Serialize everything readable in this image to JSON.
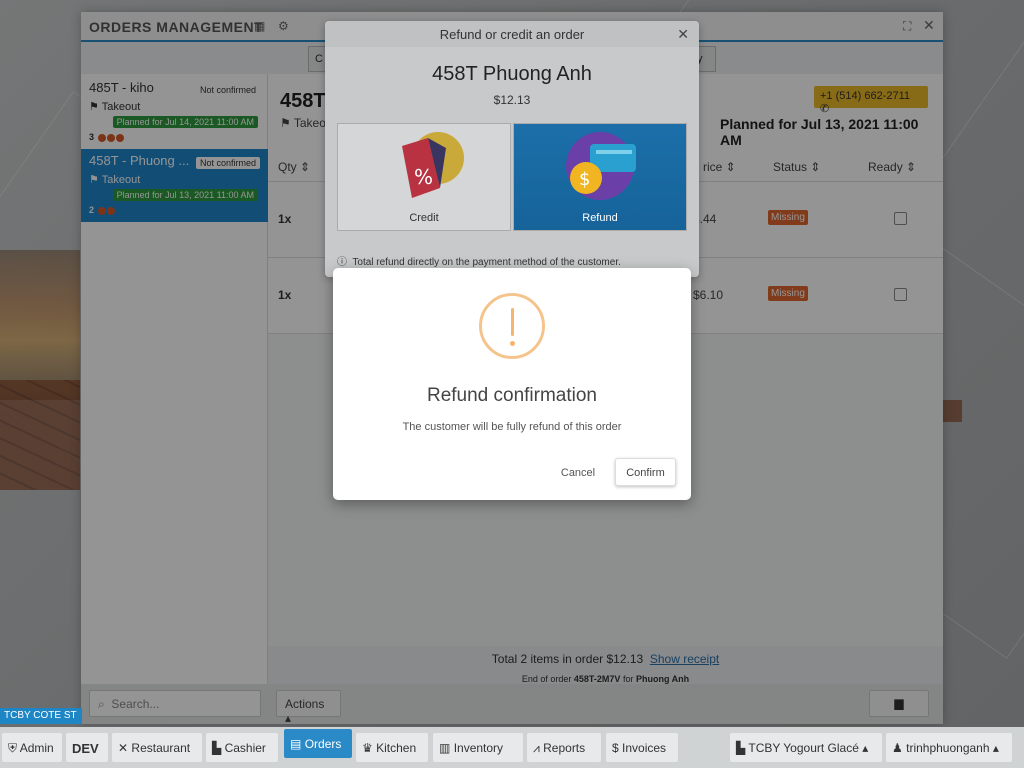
{
  "window": {
    "title": "ORDERS MANAGEMENT"
  },
  "tabs": [
    {
      "label": "C"
    },
    {
      "label": "y"
    }
  ],
  "orders": [
    {
      "name": "485T - kiho",
      "status": "Not confirmed",
      "type": "Takeout",
      "planned": "Planned for Jul 14, 2021 11:00 AM",
      "count": "3"
    },
    {
      "name": "458T - Phuong ...",
      "status": "Not confirmed",
      "type": "Takeout",
      "planned": "Planned for Jul 13, 2021 11:00 AM",
      "count": "2"
    }
  ],
  "detail": {
    "title": "458T",
    "type": "Takeout",
    "phone": "+1 (514) 662-2711",
    "planned": "Planned for Jul 13, 2021 11:00 AM",
    "columns": {
      "qty": "Qty",
      "price": "rice",
      "status": "Status",
      "ready": "Ready"
    },
    "items": [
      {
        "qty": "1x",
        "price": "4.44",
        "status": "Missing"
      },
      {
        "qty": "1x",
        "price": "$6.10",
        "status": "Missing"
      }
    ],
    "total_text": "Total 2 items in order $12.13",
    "show_receipt": "Show receipt",
    "end_prefix": "End of order",
    "end_code": "458T-2M7V",
    "end_for": "for",
    "end_name": "Phuong Anh"
  },
  "bottom": {
    "search_placeholder": "Search...",
    "actions": "Actions"
  },
  "refund_dialog": {
    "title": "Refund or credit an order",
    "customer": "458T Phuong Anh",
    "amount": "$12.13",
    "credit_label": "Credit",
    "refund_label": "Refund",
    "note": "Total refund directly on the payment method of the customer."
  },
  "confirm_dialog": {
    "title": "Refund confirmation",
    "text": "The customer will be fully refund of this order",
    "cancel": "Cancel",
    "confirm": "Confirm"
  },
  "store_label": "TCBY COTE ST",
  "taskbar": [
    {
      "label": "Admin",
      "icon": "shield-icon"
    },
    {
      "label": "DEV",
      "icon": ""
    },
    {
      "label": "Restaurant",
      "icon": "utensils-icon"
    },
    {
      "label": "Cashier",
      "icon": "cash-register-icon"
    },
    {
      "label": "Orders",
      "icon": "clipboard-icon"
    },
    {
      "label": "Kitchen",
      "icon": "chef-hat-icon"
    },
    {
      "label": "Inventory",
      "icon": "warehouse-icon"
    },
    {
      "label": "Reports",
      "icon": "chart-icon"
    },
    {
      "label": "Invoices",
      "icon": "dollar-icon"
    },
    {
      "label": "TCBY Yogourt Glacé",
      "icon": "store-icon"
    },
    {
      "label": "trinhphuonganh",
      "icon": "user-icon"
    }
  ],
  "colors": {
    "accent": "#2a8ac8",
    "missing": "#e0662e",
    "planned": "#2e9a3e",
    "phone": "#e8b829"
  }
}
